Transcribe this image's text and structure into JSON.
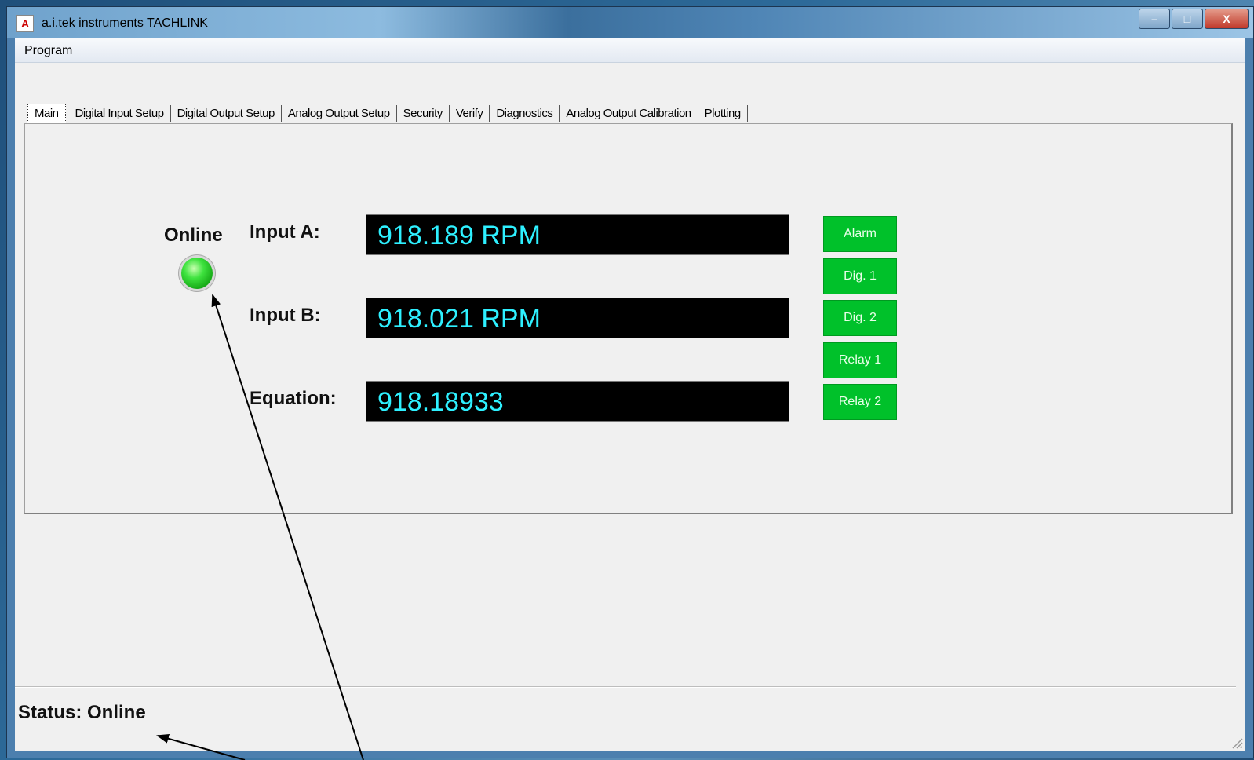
{
  "window": {
    "title": "a.i.tek instruments TACHLINK",
    "icon_letter": "A",
    "controls": {
      "minimize": "–",
      "maximize": "□",
      "close": "X"
    }
  },
  "menu": {
    "items": [
      "Program"
    ]
  },
  "tabs": [
    {
      "label": "Main",
      "active": true
    },
    {
      "label": "Digital Input Setup"
    },
    {
      "label": "Digital Output Setup"
    },
    {
      "label": "Analog Output Setup"
    },
    {
      "label": "Security"
    },
    {
      "label": "Verify"
    },
    {
      "label": "Diagnostics"
    },
    {
      "label": "Analog Output Calibration"
    },
    {
      "label": "Plotting"
    }
  ],
  "main": {
    "online_label": "Online",
    "led_color": "#3fe33f",
    "fields": [
      {
        "label": "Input A:",
        "value": "918.189 RPM"
      },
      {
        "label": "Input B:",
        "value": "918.021 RPM"
      },
      {
        "label": "Equation:",
        "value": "918.18933"
      }
    ],
    "display_text_color": "#2ef0ff",
    "indicator_color": "#00c12a",
    "indicators": [
      "Alarm",
      "Dig. 1",
      "Dig. 2",
      "Relay 1",
      "Relay 2"
    ]
  },
  "status": {
    "text": "Status: Online"
  }
}
